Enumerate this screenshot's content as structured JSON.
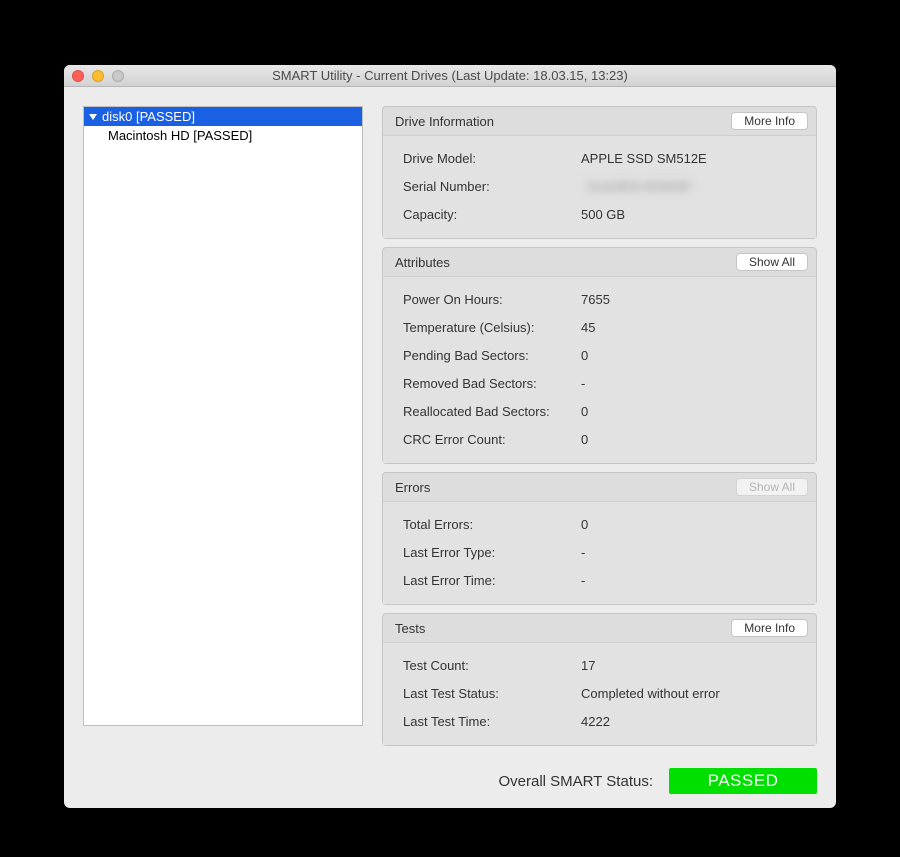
{
  "window_title": "SMART Utility - Current Drives (Last Update: 18.03.15, 13:23)",
  "sidebar": {
    "root": {
      "label": "disk0  [PASSED]"
    },
    "child": {
      "label": "Macintosh HD  [PASSED]"
    }
  },
  "drive_info": {
    "title": "Drive Information",
    "button": "More Info",
    "model_k": "Drive Model:",
    "model_v": "APPLE SSD SM512E",
    "serial_k": "Serial Number:",
    "serial_v": "S1A2B3C4D5E6F",
    "capacity_k": "Capacity:",
    "capacity_v": "500 GB"
  },
  "attributes": {
    "title": "Attributes",
    "button": "Show All",
    "rows": [
      {
        "k": "Power On Hours:",
        "v": "7655"
      },
      {
        "k": "Temperature (Celsius):",
        "v": "45"
      },
      {
        "k": "Pending Bad Sectors:",
        "v": "0"
      },
      {
        "k": "Removed Bad Sectors:",
        "v": "-"
      },
      {
        "k": "Reallocated Bad Sectors:",
        "v": "0"
      },
      {
        "k": "CRC Error Count:",
        "v": "0"
      }
    ]
  },
  "errors": {
    "title": "Errors",
    "button": "Show All",
    "rows": [
      {
        "k": "Total Errors:",
        "v": "0"
      },
      {
        "k": "Last Error Type:",
        "v": "-"
      },
      {
        "k": "Last Error Time:",
        "v": "-"
      }
    ]
  },
  "tests": {
    "title": "Tests",
    "button": "More Info",
    "rows": [
      {
        "k": "Test Count:",
        "v": "17"
      },
      {
        "k": "Last Test Status:",
        "v": "Completed without error"
      },
      {
        "k": "Last Test Time:",
        "v": "4222"
      }
    ]
  },
  "overall": {
    "label": "Overall SMART Status:",
    "status": "PASSED"
  }
}
